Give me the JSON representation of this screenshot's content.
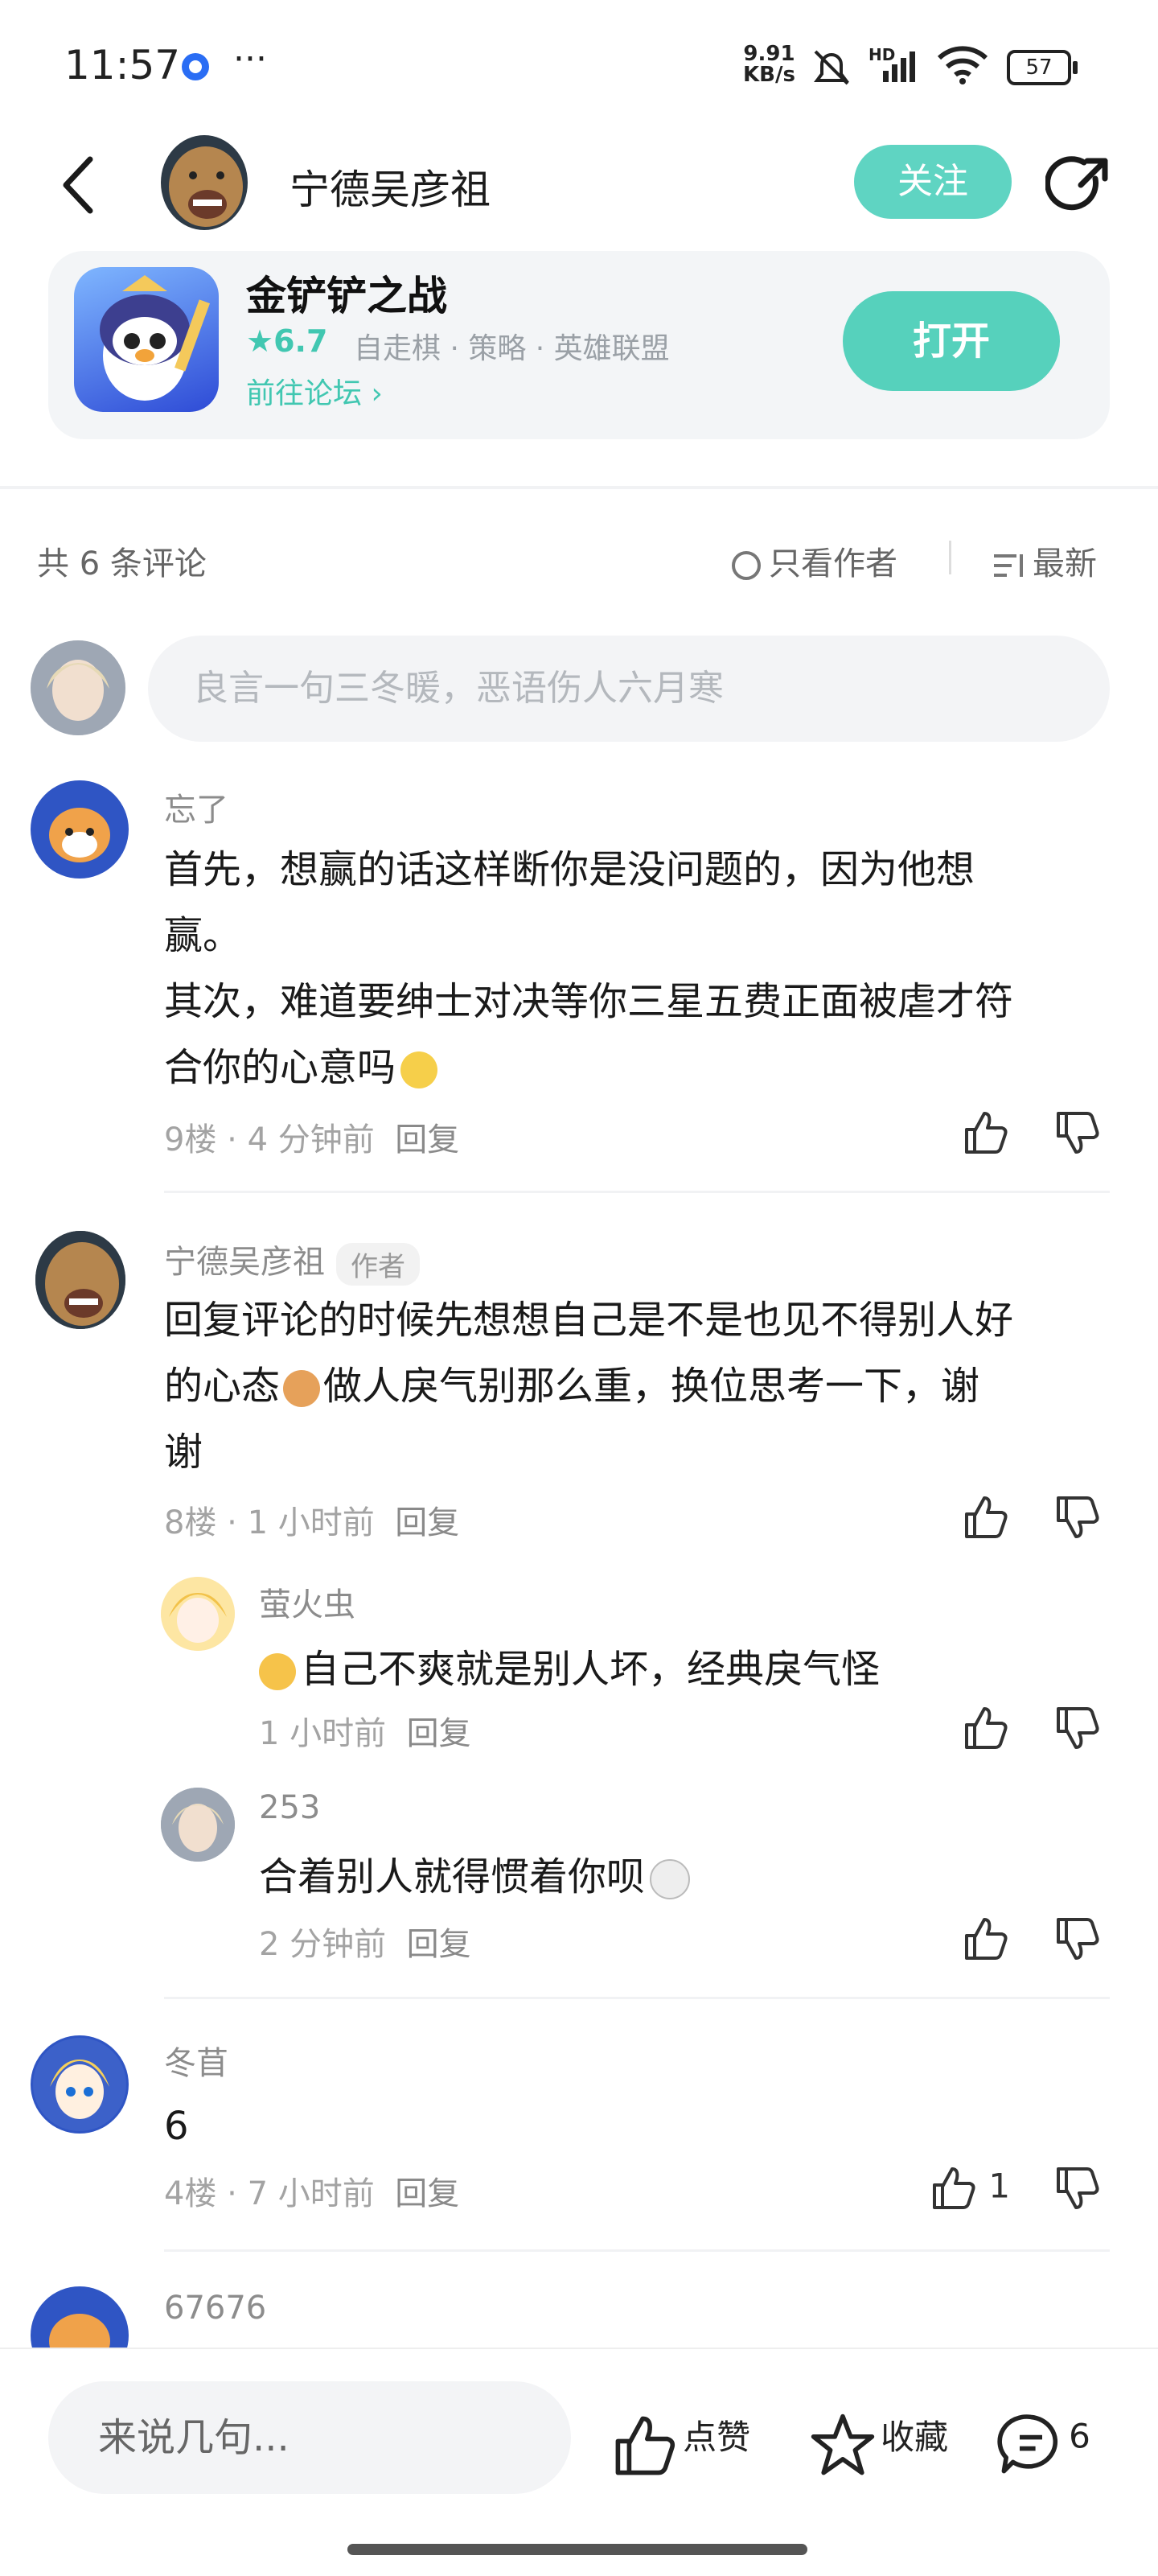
{
  "status_bar": {
    "time": "11:57",
    "more": "···",
    "net_speed_value": "9.91",
    "net_speed_unit": "KB/s",
    "network_type": "HD",
    "battery": "57"
  },
  "header": {
    "author_name": "宁德吴彦祖",
    "follow_label": "关注"
  },
  "game": {
    "name": "金铲铲之战",
    "rating": "6.7",
    "tags": "自走棋 · 策略 · 英雄联盟",
    "forum_link": "前往论坛",
    "open_label": "打开"
  },
  "comments_header": {
    "count": "共 6 条评论",
    "author_only": "只看作者",
    "sort": "最新"
  },
  "input": {
    "placeholder": "良言一句三冬暖，恶语伤人六月寒"
  },
  "comments": [
    {
      "user": "忘了",
      "lines": [
        "首先，想赢的话这样断你是没问题的，因为他想",
        "赢。",
        "其次，难道要绅士对决等你三星五费正面被虐才符",
        "合你的心意吗"
      ],
      "floor_time": "9楼 · 4 分钟前",
      "reply": "回复"
    },
    {
      "user": "宁德吴彦祖",
      "author_tag": "作者",
      "lines": [
        "回复评论的时候先想想自己是不是也见不得别人好",
        "的心态",
        "做人戾气别那么重，换位思考一下，谢",
        "谢"
      ],
      "floor_time": "8楼 · 1 小时前",
      "reply": "回复",
      "replies": [
        {
          "user": "萤火虫",
          "text": "自己不爽就是别人坏，经典戾气怪",
          "time": "1 小时前",
          "reply": "回复"
        },
        {
          "user": "253",
          "text": "合着别人就得惯着你呗",
          "time": "2 分钟前",
          "reply": "回复"
        }
      ]
    },
    {
      "user": "冬苜",
      "lines": [
        "6"
      ],
      "floor_time": "4楼 · 7 小时前",
      "reply": "回复",
      "likes": "1"
    },
    {
      "user": "67676"
    }
  ],
  "bottom_bar": {
    "placeholder": "来说几句...",
    "like_label": "点赞",
    "fav_label": "收藏",
    "comment_count": "6"
  },
  "colors": {
    "accent": "#56d1bc",
    "rating": "#41c7b1"
  },
  "icons": [
    "back-arrow-icon",
    "share-icon",
    "star-icon",
    "chevron-right-icon",
    "radio-icon",
    "sort-icon",
    "thumb-up-icon",
    "thumb-down-icon",
    "star-outline-icon",
    "comment-bubble-icon",
    "emoji-icon"
  ]
}
